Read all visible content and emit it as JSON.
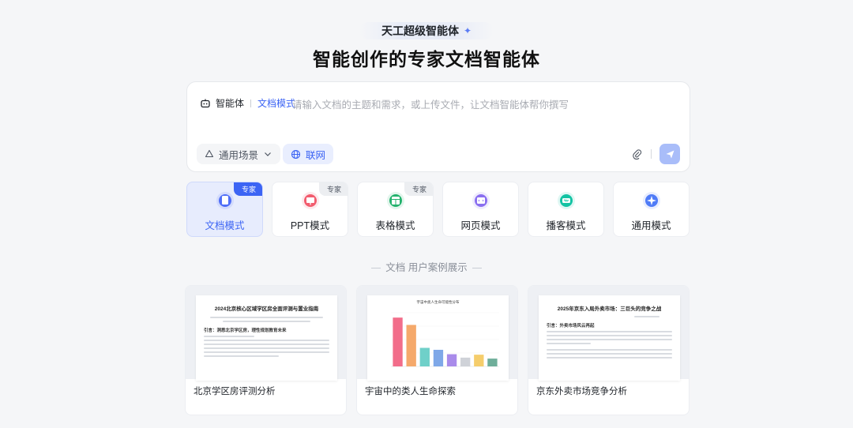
{
  "header": {
    "badge": "天工超级智能体",
    "title": "智能创作的专家文档智能体"
  },
  "input": {
    "agent_label": "智能体",
    "mode_label": "文档模式",
    "placeholder": "请输入文档的主题和需求，或上传文件，让文档智能体帮你撰写",
    "scene_label": "通用场景",
    "network_label": "联网"
  },
  "modes": [
    {
      "label": "文档模式",
      "tag": "专家",
      "icon": "doc-icon",
      "color": "#4f6ef7",
      "active": true
    },
    {
      "label": "PPT模式",
      "tag": "专家",
      "icon": "ppt-icon",
      "color": "#f25c6e",
      "active": false
    },
    {
      "label": "表格模式",
      "tag": "专家",
      "icon": "table-icon",
      "color": "#23b26d",
      "active": false
    },
    {
      "label": "网页模式",
      "tag": "",
      "icon": "webpage-icon",
      "color": "#8a6ff0",
      "active": false
    },
    {
      "label": "播客模式",
      "tag": "",
      "icon": "podcast-icon",
      "color": "#12c3a3",
      "active": false
    },
    {
      "label": "通用模式",
      "tag": "",
      "icon": "sparkle-icon",
      "color": "#4f7bf7",
      "active": false
    }
  ],
  "cases_section": {
    "title": "文档 用户案例展示"
  },
  "cases": [
    {
      "caption": "北京学区房评测分析",
      "doc_title": "2024北京核心区域学区房全面评测与置业指南",
      "doc_heading": "引言：洞悉北京学区房，理性规划教育未来"
    },
    {
      "caption": "宇宙中的类人生命探索",
      "chart_title": "宇宙中类人生命可能性分布"
    },
    {
      "caption": "京东外卖市场竞争分析",
      "doc_title": "2025年京东入局外卖市场：三巨头的竞争之战",
      "doc_heading": "引言：外卖市场风云再起"
    }
  ],
  "chart_data": {
    "type": "bar",
    "title": "宇宙中类人生命可能性分布",
    "categories": [
      "",
      "",
      "",
      "",
      "",
      "",
      "",
      ""
    ],
    "values": [
      100,
      85,
      38,
      34,
      25,
      18,
      24,
      16
    ],
    "colors": [
      "#f26d8a",
      "#f5a96b",
      "#6fd0c9",
      "#7fa8e8",
      "#a98bea",
      "#cfd2d8",
      "#f5cd6b",
      "#6fae9a"
    ],
    "ylim": [
      0,
      110
    ]
  }
}
